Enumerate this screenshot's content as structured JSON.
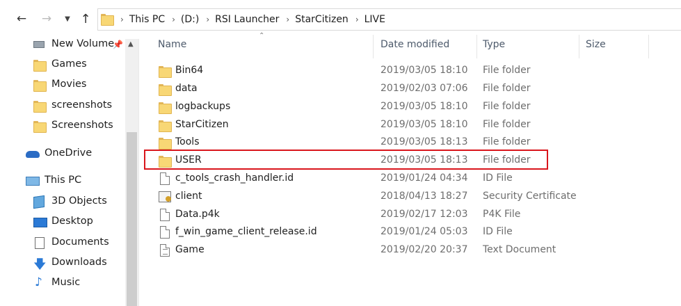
{
  "nav": {
    "back_icon": "arrow-left-icon",
    "forward_icon": "arrow-right-icon",
    "recent_icon": "chevron-down-icon",
    "up_icon": "arrow-up-icon",
    "breadcrumbs": [
      "This PC",
      "(D:)",
      "RSI Launcher",
      "StarCitizen",
      "LIVE"
    ]
  },
  "sidebar": {
    "items": [
      {
        "label": "New Volume",
        "icon": "drive-icon",
        "pinned": true
      },
      {
        "label": "Games",
        "icon": "folder-icon"
      },
      {
        "label": "Movies",
        "icon": "folder-icon"
      },
      {
        "label": "screenshots",
        "icon": "folder-icon"
      },
      {
        "label": "Screenshots",
        "icon": "folder-icon"
      },
      {
        "label": "OneDrive",
        "icon": "cloud-icon"
      },
      {
        "label": "This PC",
        "icon": "computer-icon"
      },
      {
        "label": "3D Objects",
        "icon": "cube-icon"
      },
      {
        "label": "Desktop",
        "icon": "desktop-icon"
      },
      {
        "label": "Documents",
        "icon": "documents-icon"
      },
      {
        "label": "Downloads",
        "icon": "download-icon"
      },
      {
        "label": "Music",
        "icon": "music-icon"
      }
    ]
  },
  "columns": {
    "name": "Name",
    "date": "Date modified",
    "type": "Type",
    "size": "Size"
  },
  "files": [
    {
      "name": "Bin64",
      "date": "2019/03/05 18:10",
      "type": "File folder",
      "kind": "folder"
    },
    {
      "name": "data",
      "date": "2019/02/03 07:06",
      "type": "File folder",
      "kind": "folder"
    },
    {
      "name": "logbackups",
      "date": "2019/03/05 18:10",
      "type": "File folder",
      "kind": "folder"
    },
    {
      "name": "StarCitizen",
      "date": "2019/03/05 18:10",
      "type": "File folder",
      "kind": "folder"
    },
    {
      "name": "Tools",
      "date": "2019/03/05 18:13",
      "type": "File folder",
      "kind": "folder"
    },
    {
      "name": "USER",
      "date": "2019/03/05 18:13",
      "type": "File folder",
      "kind": "folder",
      "highlighted": true
    },
    {
      "name": "c_tools_crash_handler.id",
      "date": "2019/01/24 04:34",
      "type": "ID File",
      "kind": "file"
    },
    {
      "name": "client",
      "date": "2018/04/13 18:27",
      "type": "Security Certificate",
      "kind": "certificate"
    },
    {
      "name": "Data.p4k",
      "date": "2019/02/17 12:03",
      "type": "P4K File",
      "kind": "file"
    },
    {
      "name": "f_win_game_client_release.id",
      "date": "2019/01/24 05:03",
      "type": "ID File",
      "kind": "file"
    },
    {
      "name": "Game",
      "date": "2019/02/20 20:37",
      "type": "Text Document",
      "kind": "text"
    }
  ],
  "colors": {
    "highlight_border": "#d9151c",
    "folder_yellow": "#f8d775"
  }
}
